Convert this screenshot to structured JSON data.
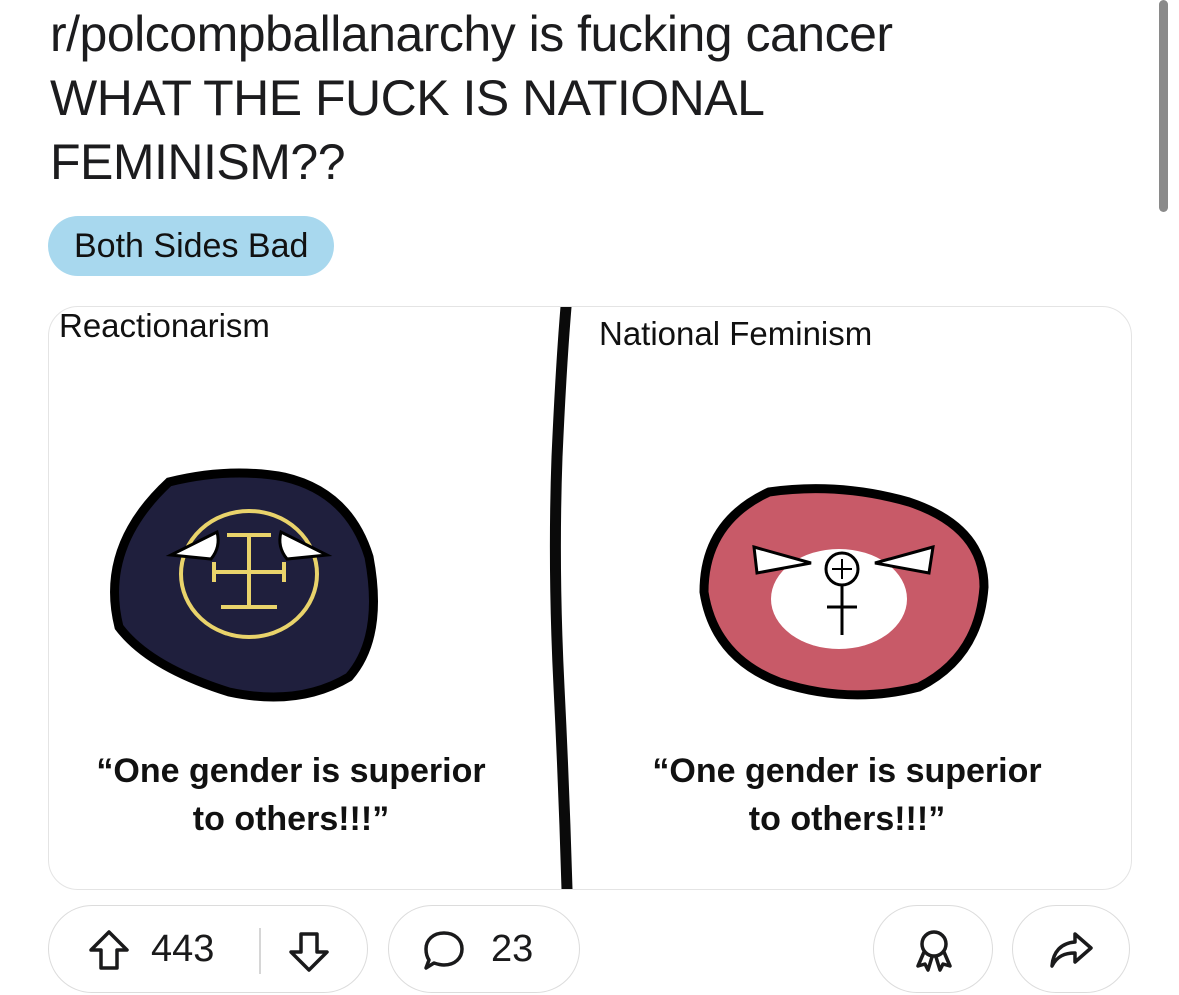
{
  "post": {
    "title_lines": [
      "r/polcompballanarchy is fucking cancer",
      "WHAT THE FUCK IS NATIONAL",
      "FEMINISM??"
    ],
    "flair": "Both Sides Bad"
  },
  "image": {
    "left_panel": {
      "title": "Reactionarism",
      "quote_line1": "“One gender is superior",
      "quote_line2": "to others!!!”",
      "ball_color": "#1f1f3d",
      "symbol_color": "#e9d36b"
    },
    "right_panel": {
      "title": "National Feminism",
      "quote_line1": "“One gender is superior",
      "quote_line2": "to others!!!”",
      "ball_color": "#c85a68"
    }
  },
  "actions": {
    "upvote_icon": "arrow-up-icon",
    "vote_count": "443",
    "downvote_icon": "arrow-down-icon",
    "comment_icon": "speech-bubble-icon",
    "comment_count": "23",
    "award_icon": "award-icon",
    "share_icon": "share-arrow-icon"
  }
}
